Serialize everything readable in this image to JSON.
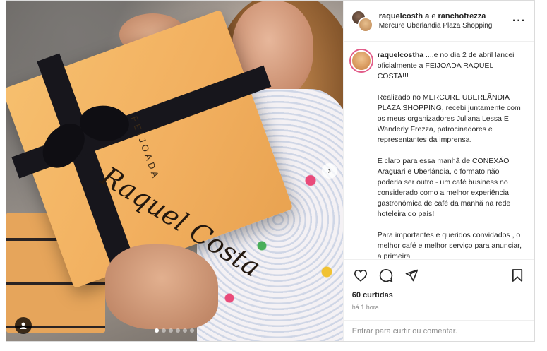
{
  "header": {
    "user_primary": "raquelcosth a",
    "connector": "e",
    "user_secondary": "ranchofrezza",
    "location": "Mercure Uberlandia Plaza Shopping",
    "more_icon": "more-horizontal-icon"
  },
  "media": {
    "gift_label_top": "FEIJOADA",
    "gift_label_script": "Raquel Costa",
    "next_icon": "chevron-right-icon",
    "tag_icon": "user-tag-icon",
    "carousel_dot_count": 6,
    "carousel_active_index": 0
  },
  "caption": {
    "username": "raquelcostha",
    "paragraphs": [
      "....e no dia 2 de abril lancei oficialmente a FEIJOADA RAQUEL COSTA!!!",
      "Realizado no MERCURE UBERLÂNDIA PLAZA SHOPPING, recebi juntamente com os meus organizadores Juliana Lessa E Wanderly Frezza, patrocinadores e representantes da imprensa.",
      "E claro para essa manhã de CONEXÃO Araguari e Uberlândia, o formato não poderia ser outro - um café business no considerado como a melhor experiência gastronômica de café da manhã na rede hoteleira do país!",
      "Para importantes e queridos convidados , o melhor café e melhor serviço para anunciar, a primeira"
    ]
  },
  "actions": {
    "like_icon": "heart-icon",
    "comment_icon": "comment-icon",
    "share_icon": "send-icon",
    "save_icon": "bookmark-icon"
  },
  "stats": {
    "likes": "60 curtidas",
    "time": "há 1 hora"
  },
  "comment": {
    "placeholder": "Entrar para curtir ou comentar."
  }
}
